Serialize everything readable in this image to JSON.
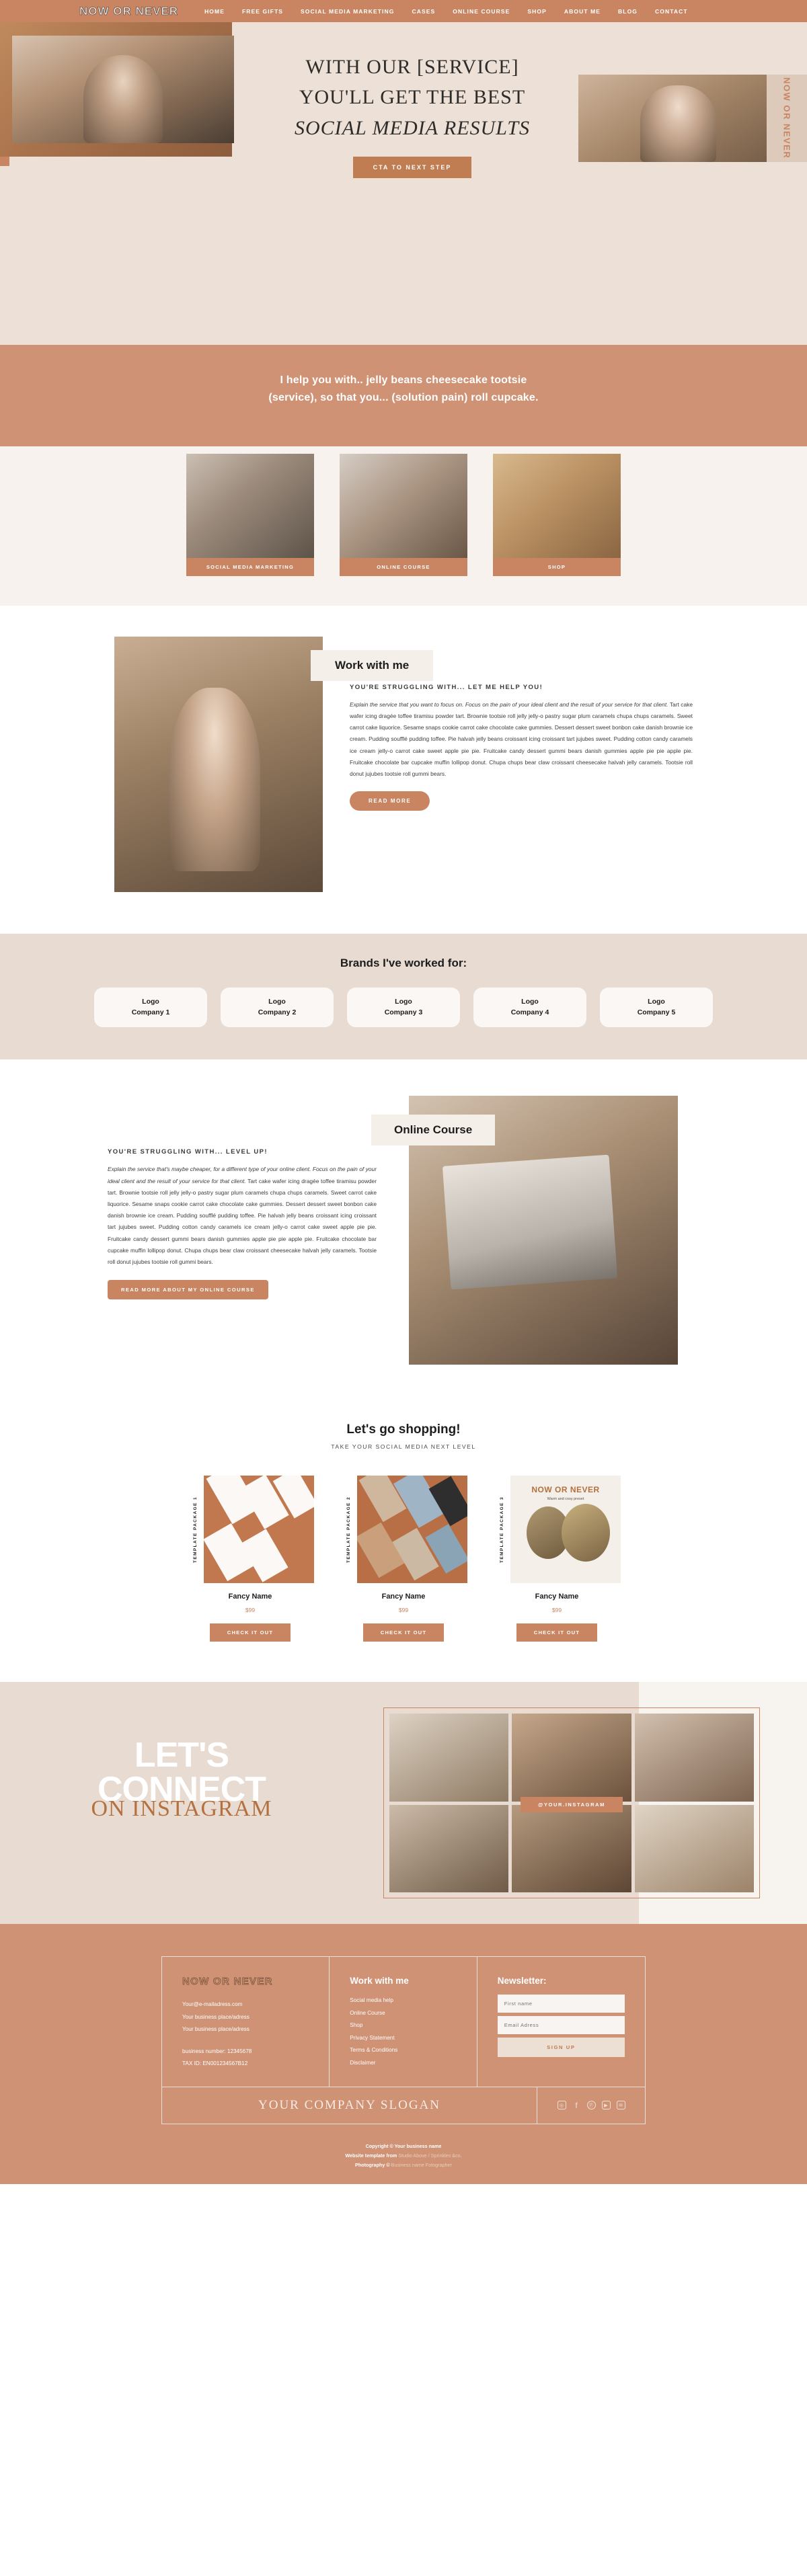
{
  "brand": {
    "name": "NOW OR NEVER"
  },
  "nav": {
    "items": [
      {
        "label": "HOME"
      },
      {
        "label": "FREE GIFTS"
      },
      {
        "label": "SOCIAL MEDIA MARKETING"
      },
      {
        "label": "CASES"
      },
      {
        "label": "ONLINE COURSE"
      },
      {
        "label": "SHOP"
      },
      {
        "label": "ABOUT ME"
      },
      {
        "label": "BLOG"
      },
      {
        "label": "CONTACT"
      }
    ]
  },
  "hero": {
    "line1": "WITH OUR [SERVICE]",
    "line2": "YOU'LL GET THE BEST",
    "line3": "SOCIAL MEDIA RESULTS",
    "cta": "CTA TO NEXT STEP",
    "side_logo": "NOW OR NEVER"
  },
  "help_band": {
    "line1": "I help you with.. jelly beans cheesecake tootsie",
    "line2": "(service), so that you... (solution pain) roll cupcake."
  },
  "service_cards": [
    {
      "label": "SOCIAL MEDIA MARKETING"
    },
    {
      "label": "ONLINE COURSE"
    },
    {
      "label": "SHOP"
    }
  ],
  "work": {
    "title": "Work with me",
    "eyebrow": "YOU'RE STRUGGLING WITH... LET ME HELP YOU!",
    "italic_intro": "Explain the service that you want to focus on. Focus on the pain of your ideal client and the result of your service for that client.",
    "body": " Tart cake wafer icing dragée toffee tiramisu powder tart. Brownie tootsie roll jelly jelly-o pastry sugar plum caramels chupa chups caramels. Sweet carrot cake liquorice. Sesame snaps cookie carrot cake chocolate cake gummies. Dessert dessert sweet bonbon cake danish brownie ice cream. Pudding soufflé pudding toffee. Pie halvah jelly beans croissant icing croissant tart jujubes sweet. Pudding cotton candy caramels ice cream jelly-o carrot cake sweet apple pie pie. Fruitcake candy dessert gummi bears danish gummies apple pie pie apple pie. Fruitcake chocolate bar cupcake muffin lollipop donut. Chupa chups bear claw croissant cheesecake halvah jelly caramels. Tootsie roll donut jujubes tootsie roll gummi bears.",
    "button": "READ MORE"
  },
  "brands": {
    "title": "Brands I've worked for:",
    "items": [
      {
        "line1": "Logo",
        "line2": "Company 1"
      },
      {
        "line1": "Logo",
        "line2": "Company 2"
      },
      {
        "line1": "Logo",
        "line2": "Company 3"
      },
      {
        "line1": "Logo",
        "line2": "Company 4"
      },
      {
        "line1": "Logo",
        "line2": "Company 5"
      }
    ]
  },
  "course": {
    "title": "Online Course",
    "eyebrow": "YOU'RE STRUGGLING WITH... LEVEL UP!",
    "italic_intro": "Explain the service that's maybe cheaper, for a different type of your online client. Focus on the pain of your ideal client and the result of your service for that client.",
    "body": " Tart cake wafer icing dragée toffee tiramisu powder tart. Brownie tootsie roll jelly jelly-o pastry sugar plum caramels chupa chups caramels. Sweet carrot cake liquorice. Sesame snaps cookie carrot cake chocolate cake gummies. Dessert dessert sweet bonbon cake danish brownie ice cream. Pudding soufflé pudding toffee. Pie halvah jelly beans croissant icing croissant tart jujubes sweet. Pudding cotton candy caramels ice cream jelly-o carrot cake sweet apple pie pie. Fruitcake candy dessert gummi bears danish gummies apple pie pie apple pie. Fruitcake chocolate bar cupcake muffin lollipop donut. Chupa chups bear claw croissant cheesecake halvah jelly caramels. Tootsie roll donut jujubes tootsie roll gummi bears.",
    "button": "READ MORE ABOUT MY ONLINE COURSE"
  },
  "shop": {
    "title": "Let's go shopping!",
    "subtitle": "TAKE YOUR SOCIAL MEDIA NEXT LEVEL",
    "products": [
      {
        "tag": "TEMPLATE PACKAGE 1",
        "name": "Fancy Name",
        "price": "$99",
        "button": "CHECK IT OUT"
      },
      {
        "tag": "TEMPLATE PACKAGE 2",
        "name": "Fancy Name",
        "price": "$99",
        "button": "CHECK IT OUT"
      },
      {
        "tag": "TEMPLATE PACKAGE 3",
        "name": "Fancy Name",
        "price": "$99",
        "button": "CHECK IT OUT",
        "preset_title": "NOW OR NEVER",
        "preset_sub": "Warm and cosy preset"
      }
    ]
  },
  "instagram": {
    "line1": "LET'S",
    "line2": "CONNECT",
    "line3": "ON INSTAGRAM",
    "handle": "@YOUR.INSTAGRAM"
  },
  "footer": {
    "logo": "NOW OR NEVER",
    "contact": [
      "Your@e-mailadress.com",
      "Your business place/adress",
      "Your business place/adress"
    ],
    "legal": [
      "business number: 12345678",
      "TAX ID: EN001234567B12"
    ],
    "work_heading": "Work with me",
    "work_links": [
      "Social media help",
      "Online Course",
      "Shop",
      "Privacy Statement",
      "Terms & Conditions",
      "Disclaimer"
    ],
    "newsletter_heading": "Newsletter:",
    "first_name_placeholder": "First name",
    "email_placeholder": "Email Adress",
    "signup_button": "SIGN UP",
    "slogan": "YOUR COMPANY SLOGAN",
    "social": [
      {
        "name": "instagram-icon",
        "glyph": "◎"
      },
      {
        "name": "facebook-icon",
        "glyph": "f"
      },
      {
        "name": "pinterest-icon",
        "glyph": "℗"
      },
      {
        "name": "youtube-icon",
        "glyph": "▶"
      },
      {
        "name": "email-icon",
        "glyph": "✉"
      }
    ],
    "copyright_line1": "Copyright © Your business name",
    "copyright_line2_strong": "Website template from ",
    "copyright_line2_dim": "Studio Above / Sprinkles &co.",
    "copyright_line3_strong": "Photography © ",
    "copyright_line3_dim": "Business name Fotographer"
  },
  "colors": {
    "accent": "#c98562",
    "band": "#cf9275",
    "cream": "#ede0d6",
    "sand": "#e8dbd1"
  }
}
